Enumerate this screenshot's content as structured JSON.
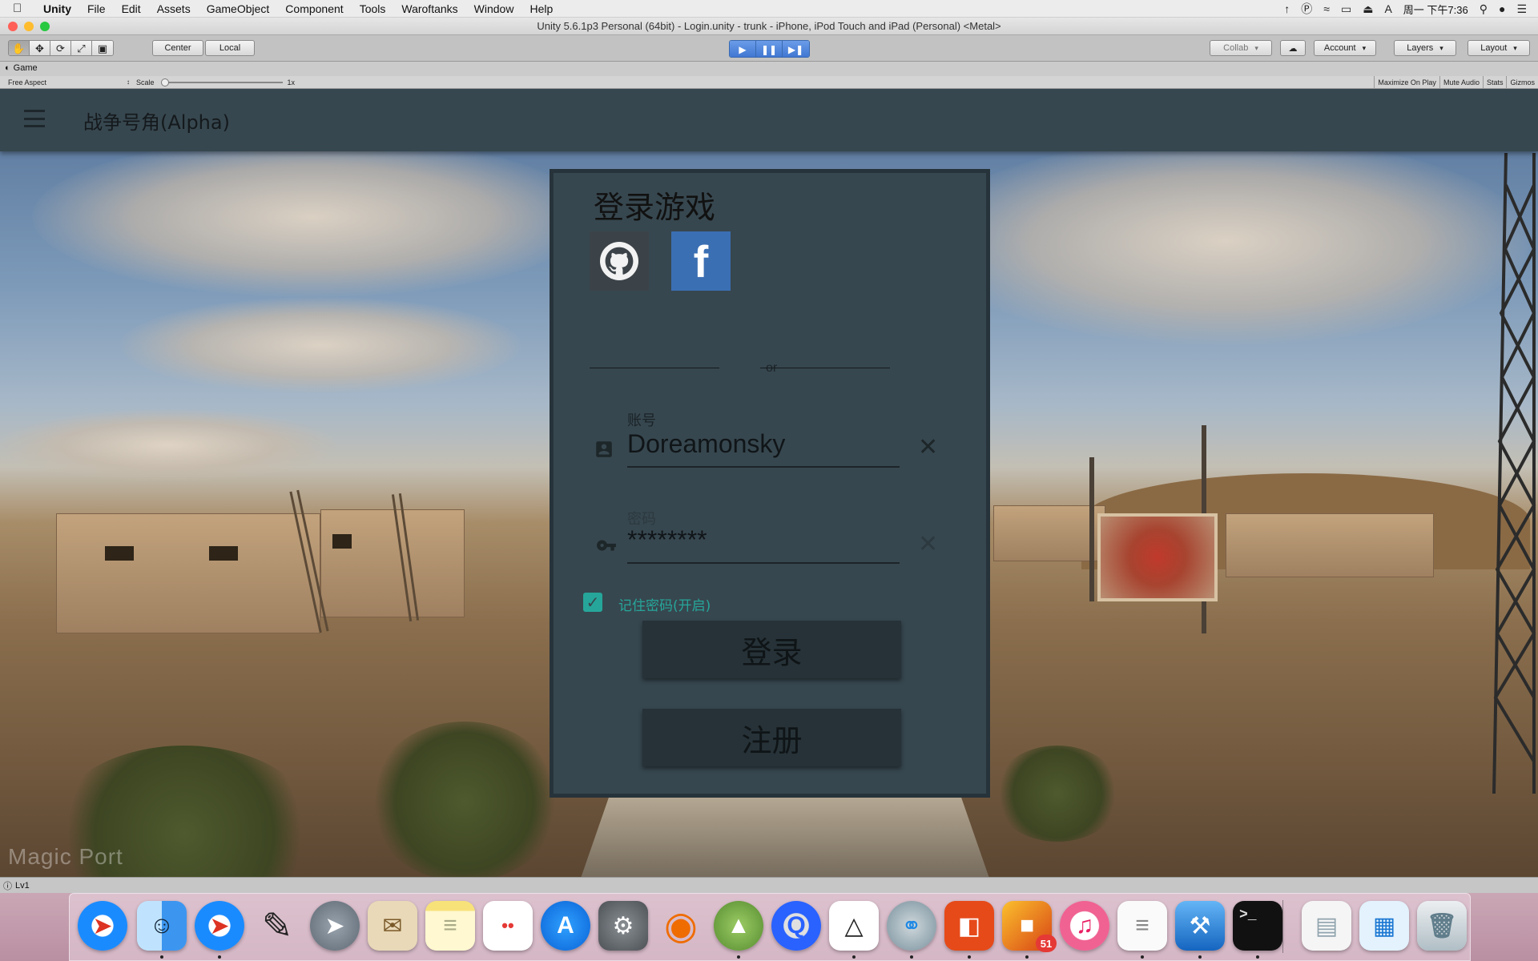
{
  "menubar": {
    "app": "Unity",
    "items": [
      "File",
      "Edit",
      "Assets",
      "GameObject",
      "Component",
      "Tools",
      "Waroftanks",
      "Window",
      "Help"
    ],
    "clock": "周一 下午7:36"
  },
  "window": {
    "title": "Unity 5.6.1p3 Personal (64bit) - Login.unity - trunk - iPhone, iPod Touch and iPad (Personal) <Metal>"
  },
  "toolbar": {
    "pivot": "Center",
    "space": "Local",
    "collab": "Collab",
    "account": "Account",
    "layers": "Layers",
    "layout": "Layout"
  },
  "game_tab": {
    "label": "Game",
    "aspect": "Free Aspect",
    "scale_label": "Scale",
    "scale_value": "1x",
    "buttons": [
      "Maximize On Play",
      "Mute Audio",
      "Stats",
      "Gizmos"
    ]
  },
  "app": {
    "title": "战争号角(Alpha)",
    "login": {
      "title": "登录游戏",
      "or_text": "or",
      "account_label": "账号",
      "account_value": "Doreamonsky",
      "password_label": "密码",
      "password_value": "********",
      "remember_label": "记住密码(开启)",
      "remember_checked": true,
      "login_button": "登录",
      "register_button": "注册",
      "facebook_glyph": "f"
    },
    "watermark": "Magic Port"
  },
  "statusbar": {
    "text": "Lv1"
  },
  "dock": {
    "badge_count": "51",
    "apps": [
      "safari-icon",
      "finder-icon",
      "safari-icon",
      "pencil-icon",
      "launchpad-icon",
      "mail-icon",
      "notes-icon",
      "reminders-icon",
      "app-store-icon",
      "system-preferences-icon",
      "blender-icon",
      "android-studio-icon",
      "quicktime-icon",
      "unity-icon",
      "remote-desktop-icon",
      "screen-share-icon",
      "package-icon",
      "itunes-icon",
      "textedit-icon",
      "xcode-icon",
      "terminal-icon",
      "documents-icon",
      "preview-icon",
      "trash-icon"
    ]
  },
  "colors": {
    "appbar": "#37474f",
    "accent": "#26a69a",
    "facebook": "#3b6fb3",
    "button": "#263238"
  }
}
